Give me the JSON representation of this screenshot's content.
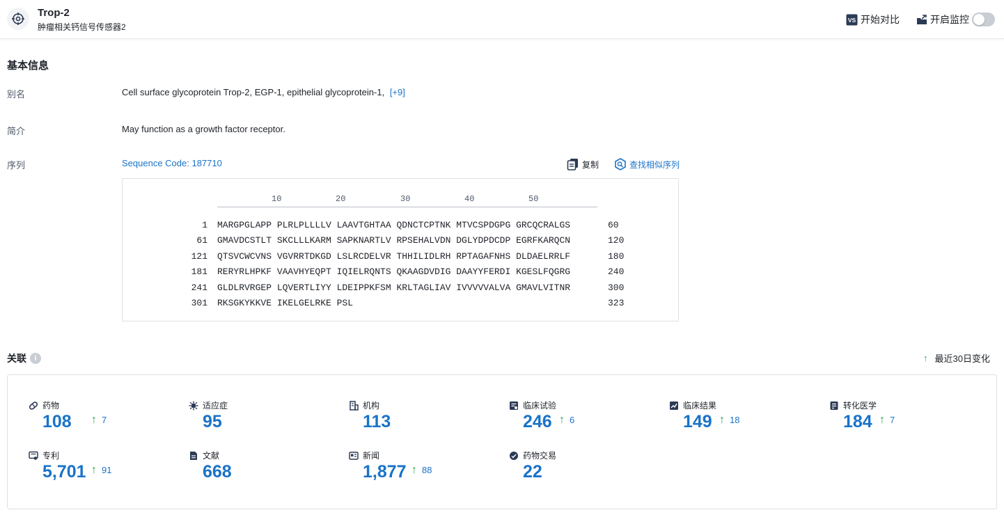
{
  "header": {
    "title": "Trop-2",
    "subtitle": "肿瘤相关钙信号传感器2",
    "compare_label": "开始对比",
    "monitor_label": "开启监控",
    "compare_icon_text": "VS"
  },
  "basic_info": {
    "section_title": "基本信息",
    "alias_label": "别名",
    "alias_value": "Cell surface glycoprotein Trop-2,  EGP-1,  epithelial glycoprotein-1,",
    "alias_more": "[+9]",
    "summary_label": "简介",
    "summary_value": "May function as a growth factor receptor.",
    "sequence_label": "序列",
    "sequence_code": "Sequence Code: 187710",
    "copy_label": "复制",
    "find_similar_label": "查找相似序列"
  },
  "sequence": {
    "ruler": [
      "10",
      "20",
      "30",
      "40",
      "50"
    ],
    "rows": [
      {
        "start": "1",
        "residues": "MARGPGLAPP PLRLPLLLLV LAAVTGHTAA QDNCTCPTNK MTVCSPDGPG GRCQCRALGS",
        "end": "60"
      },
      {
        "start": "61",
        "residues": "GMAVDCSTLT SKCLLLKARM SAPKNARTLV RPSEHALVDN DGLYDPDCDP EGRFKARQCN",
        "end": "120"
      },
      {
        "start": "121",
        "residues": "QTSVCWCVNS VGVRRTDKGD LSLRCDELVR THHILIDLRH RPTAGAFNHS DLDAELRRLF",
        "end": "180"
      },
      {
        "start": "181",
        "residues": "RERYRLHPKF VAAVHYEQPT IQIELRQNTS QKAAGDVDIG DAAYYFERDI KGESLFQGRG",
        "end": "240"
      },
      {
        "start": "241",
        "residues": "GLDLRVRGEP LQVERTLIYY LDEIPPKFSM KRLTAGLIAV IVVVVVALVA GMAVLVITNR",
        "end": "300"
      },
      {
        "start": "301",
        "residues": "RKSGKYKKVE IKELGELRKE PSL",
        "end": "323"
      }
    ]
  },
  "associations": {
    "title": "关联",
    "info_icon_text": "i",
    "recent_change_label": "最近30日变化",
    "up_arrow": "↑",
    "stats": [
      {
        "label": "药物",
        "value": "108",
        "delta": "7",
        "icon": "pill-icon"
      },
      {
        "label": "适应症",
        "value": "95",
        "delta": "",
        "icon": "virus-icon"
      },
      {
        "label": "机构",
        "value": "113",
        "delta": "",
        "icon": "building-icon"
      },
      {
        "label": "临床试验",
        "value": "246",
        "delta": "6",
        "icon": "clinical-trial-icon"
      },
      {
        "label": "临床结果",
        "value": "149",
        "delta": "18",
        "icon": "clinical-result-icon"
      },
      {
        "label": "转化医学",
        "value": "184",
        "delta": "7",
        "icon": "translational-icon"
      },
      {
        "label": "专利",
        "value": "5,701",
        "delta": "91",
        "icon": "patent-icon"
      },
      {
        "label": "文献",
        "value": "668",
        "delta": "",
        "icon": "document-icon"
      },
      {
        "label": "新闻",
        "value": "1,877",
        "delta": "88",
        "icon": "news-icon"
      },
      {
        "label": "药物交易",
        "value": "22",
        "delta": "",
        "icon": "deal-icon"
      }
    ]
  },
  "colors": {
    "accent": "#1a73c8",
    "up": "#2da44e",
    "text": "#1f2329",
    "muted": "#4e5969",
    "border": "#dcdfe3"
  }
}
